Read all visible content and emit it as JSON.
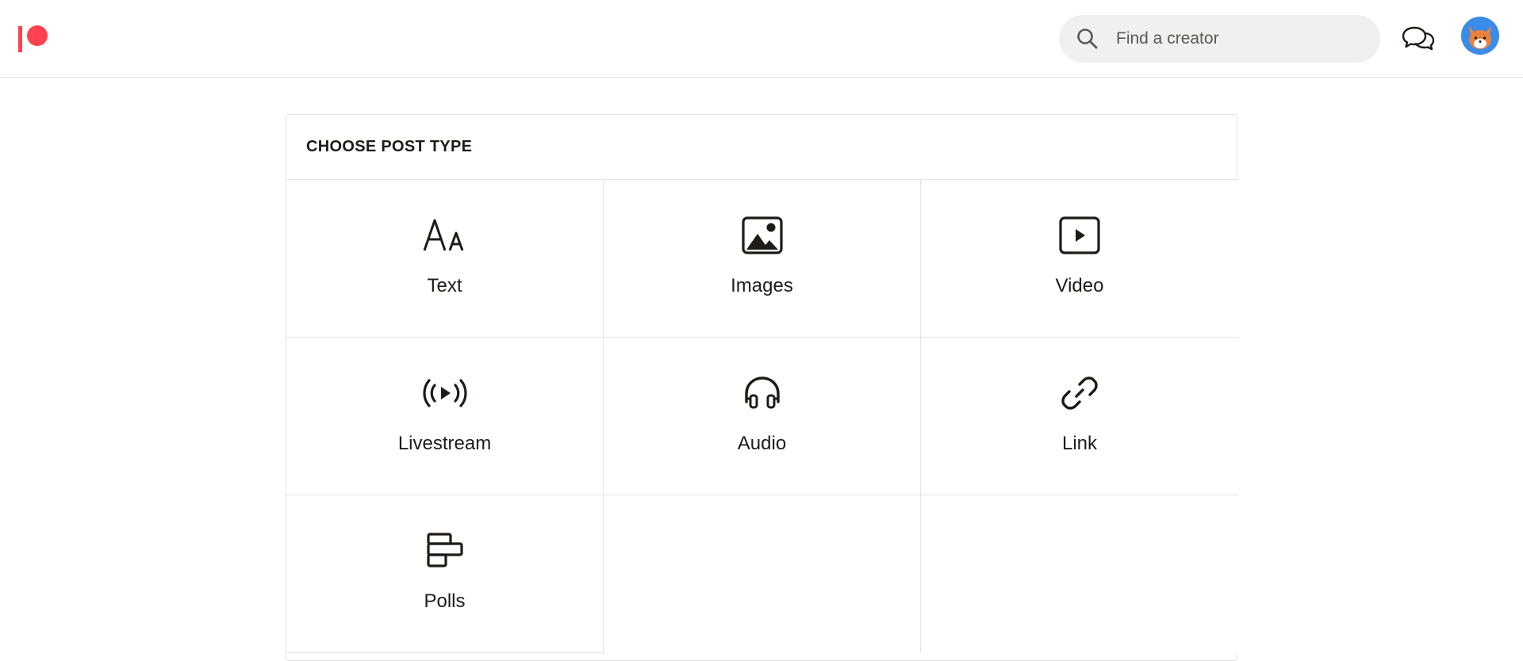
{
  "header": {
    "search_placeholder": "Find a creator",
    "icons": {
      "logo": "patreon-logo",
      "search": "search-icon",
      "messages": "chat-bubbles-icon",
      "avatar": "fox-avatar"
    }
  },
  "panel": {
    "title": "CHOOSE POST TYPE",
    "post_types": [
      {
        "label": "Text",
        "icon": "text-icon"
      },
      {
        "label": "Images",
        "icon": "image-icon"
      },
      {
        "label": "Video",
        "icon": "video-icon"
      },
      {
        "label": "Livestream",
        "icon": "livestream-icon"
      },
      {
        "label": "Audio",
        "icon": "headphones-icon"
      },
      {
        "label": "Link",
        "icon": "link-icon"
      },
      {
        "label": "Polls",
        "icon": "poll-icon"
      }
    ]
  },
  "colors": {
    "brand": "#ff424d",
    "avatar_bg": "#3b8ce8",
    "text": "#1f1b16",
    "border": "#e5e3df",
    "search_bg": "#f1f0ee"
  }
}
